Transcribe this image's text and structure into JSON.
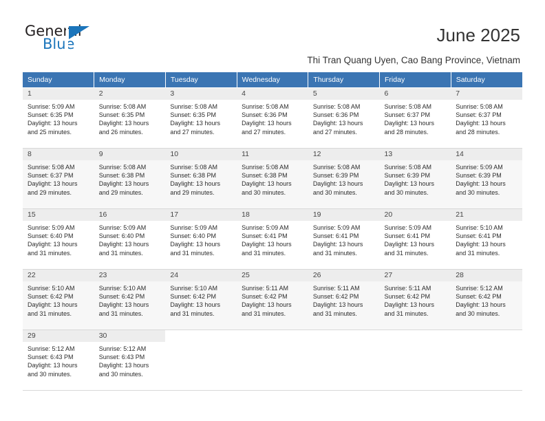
{
  "logo": {
    "primary_text": "General",
    "secondary_text": "Blue",
    "primary_color": "#231f20",
    "accent_color": "#1b75bb",
    "triangle_icon": "triangle-icon"
  },
  "header": {
    "title": "June 2025",
    "subtitle": "Thi Tran Quang Uyen, Cao Bang Province, Vietnam",
    "header_bg_color": "#3b75b3"
  },
  "calendar": {
    "weekday_headers": [
      "Sunday",
      "Monday",
      "Tuesday",
      "Wednesday",
      "Thursday",
      "Friday",
      "Saturday"
    ],
    "weeks": [
      [
        {
          "day": "1",
          "sunrise": "Sunrise: 5:09 AM",
          "sunset": "Sunset: 6:35 PM",
          "daylight_1": "Daylight: 13 hours",
          "daylight_2": "and 25 minutes."
        },
        {
          "day": "2",
          "sunrise": "Sunrise: 5:08 AM",
          "sunset": "Sunset: 6:35 PM",
          "daylight_1": "Daylight: 13 hours",
          "daylight_2": "and 26 minutes."
        },
        {
          "day": "3",
          "sunrise": "Sunrise: 5:08 AM",
          "sunset": "Sunset: 6:35 PM",
          "daylight_1": "Daylight: 13 hours",
          "daylight_2": "and 27 minutes."
        },
        {
          "day": "4",
          "sunrise": "Sunrise: 5:08 AM",
          "sunset": "Sunset: 6:36 PM",
          "daylight_1": "Daylight: 13 hours",
          "daylight_2": "and 27 minutes."
        },
        {
          "day": "5",
          "sunrise": "Sunrise: 5:08 AM",
          "sunset": "Sunset: 6:36 PM",
          "daylight_1": "Daylight: 13 hours",
          "daylight_2": "and 27 minutes."
        },
        {
          "day": "6",
          "sunrise": "Sunrise: 5:08 AM",
          "sunset": "Sunset: 6:37 PM",
          "daylight_1": "Daylight: 13 hours",
          "daylight_2": "and 28 minutes."
        },
        {
          "day": "7",
          "sunrise": "Sunrise: 5:08 AM",
          "sunset": "Sunset: 6:37 PM",
          "daylight_1": "Daylight: 13 hours",
          "daylight_2": "and 28 minutes."
        }
      ],
      [
        {
          "day": "8",
          "sunrise": "Sunrise: 5:08 AM",
          "sunset": "Sunset: 6:37 PM",
          "daylight_1": "Daylight: 13 hours",
          "daylight_2": "and 29 minutes."
        },
        {
          "day": "9",
          "sunrise": "Sunrise: 5:08 AM",
          "sunset": "Sunset: 6:38 PM",
          "daylight_1": "Daylight: 13 hours",
          "daylight_2": "and 29 minutes."
        },
        {
          "day": "10",
          "sunrise": "Sunrise: 5:08 AM",
          "sunset": "Sunset: 6:38 PM",
          "daylight_1": "Daylight: 13 hours",
          "daylight_2": "and 29 minutes."
        },
        {
          "day": "11",
          "sunrise": "Sunrise: 5:08 AM",
          "sunset": "Sunset: 6:38 PM",
          "daylight_1": "Daylight: 13 hours",
          "daylight_2": "and 30 minutes."
        },
        {
          "day": "12",
          "sunrise": "Sunrise: 5:08 AM",
          "sunset": "Sunset: 6:39 PM",
          "daylight_1": "Daylight: 13 hours",
          "daylight_2": "and 30 minutes."
        },
        {
          "day": "13",
          "sunrise": "Sunrise: 5:08 AM",
          "sunset": "Sunset: 6:39 PM",
          "daylight_1": "Daylight: 13 hours",
          "daylight_2": "and 30 minutes."
        },
        {
          "day": "14",
          "sunrise": "Sunrise: 5:09 AM",
          "sunset": "Sunset: 6:39 PM",
          "daylight_1": "Daylight: 13 hours",
          "daylight_2": "and 30 minutes."
        }
      ],
      [
        {
          "day": "15",
          "sunrise": "Sunrise: 5:09 AM",
          "sunset": "Sunset: 6:40 PM",
          "daylight_1": "Daylight: 13 hours",
          "daylight_2": "and 31 minutes."
        },
        {
          "day": "16",
          "sunrise": "Sunrise: 5:09 AM",
          "sunset": "Sunset: 6:40 PM",
          "daylight_1": "Daylight: 13 hours",
          "daylight_2": "and 31 minutes."
        },
        {
          "day": "17",
          "sunrise": "Sunrise: 5:09 AM",
          "sunset": "Sunset: 6:40 PM",
          "daylight_1": "Daylight: 13 hours",
          "daylight_2": "and 31 minutes."
        },
        {
          "day": "18",
          "sunrise": "Sunrise: 5:09 AM",
          "sunset": "Sunset: 6:41 PM",
          "daylight_1": "Daylight: 13 hours",
          "daylight_2": "and 31 minutes."
        },
        {
          "day": "19",
          "sunrise": "Sunrise: 5:09 AM",
          "sunset": "Sunset: 6:41 PM",
          "daylight_1": "Daylight: 13 hours",
          "daylight_2": "and 31 minutes."
        },
        {
          "day": "20",
          "sunrise": "Sunrise: 5:09 AM",
          "sunset": "Sunset: 6:41 PM",
          "daylight_1": "Daylight: 13 hours",
          "daylight_2": "and 31 minutes."
        },
        {
          "day": "21",
          "sunrise": "Sunrise: 5:10 AM",
          "sunset": "Sunset: 6:41 PM",
          "daylight_1": "Daylight: 13 hours",
          "daylight_2": "and 31 minutes."
        }
      ],
      [
        {
          "day": "22",
          "sunrise": "Sunrise: 5:10 AM",
          "sunset": "Sunset: 6:42 PM",
          "daylight_1": "Daylight: 13 hours",
          "daylight_2": "and 31 minutes."
        },
        {
          "day": "23",
          "sunrise": "Sunrise: 5:10 AM",
          "sunset": "Sunset: 6:42 PM",
          "daylight_1": "Daylight: 13 hours",
          "daylight_2": "and 31 minutes."
        },
        {
          "day": "24",
          "sunrise": "Sunrise: 5:10 AM",
          "sunset": "Sunset: 6:42 PM",
          "daylight_1": "Daylight: 13 hours",
          "daylight_2": "and 31 minutes."
        },
        {
          "day": "25",
          "sunrise": "Sunrise: 5:11 AM",
          "sunset": "Sunset: 6:42 PM",
          "daylight_1": "Daylight: 13 hours",
          "daylight_2": "and 31 minutes."
        },
        {
          "day": "26",
          "sunrise": "Sunrise: 5:11 AM",
          "sunset": "Sunset: 6:42 PM",
          "daylight_1": "Daylight: 13 hours",
          "daylight_2": "and 31 minutes."
        },
        {
          "day": "27",
          "sunrise": "Sunrise: 5:11 AM",
          "sunset": "Sunset: 6:42 PM",
          "daylight_1": "Daylight: 13 hours",
          "daylight_2": "and 31 minutes."
        },
        {
          "day": "28",
          "sunrise": "Sunrise: 5:12 AM",
          "sunset": "Sunset: 6:42 PM",
          "daylight_1": "Daylight: 13 hours",
          "daylight_2": "and 30 minutes."
        }
      ],
      [
        {
          "day": "29",
          "sunrise": "Sunrise: 5:12 AM",
          "sunset": "Sunset: 6:43 PM",
          "daylight_1": "Daylight: 13 hours",
          "daylight_2": "and 30 minutes."
        },
        {
          "day": "30",
          "sunrise": "Sunrise: 5:12 AM",
          "sunset": "Sunset: 6:43 PM",
          "daylight_1": "Daylight: 13 hours",
          "daylight_2": "and 30 minutes."
        },
        null,
        null,
        null,
        null,
        null
      ]
    ]
  }
}
